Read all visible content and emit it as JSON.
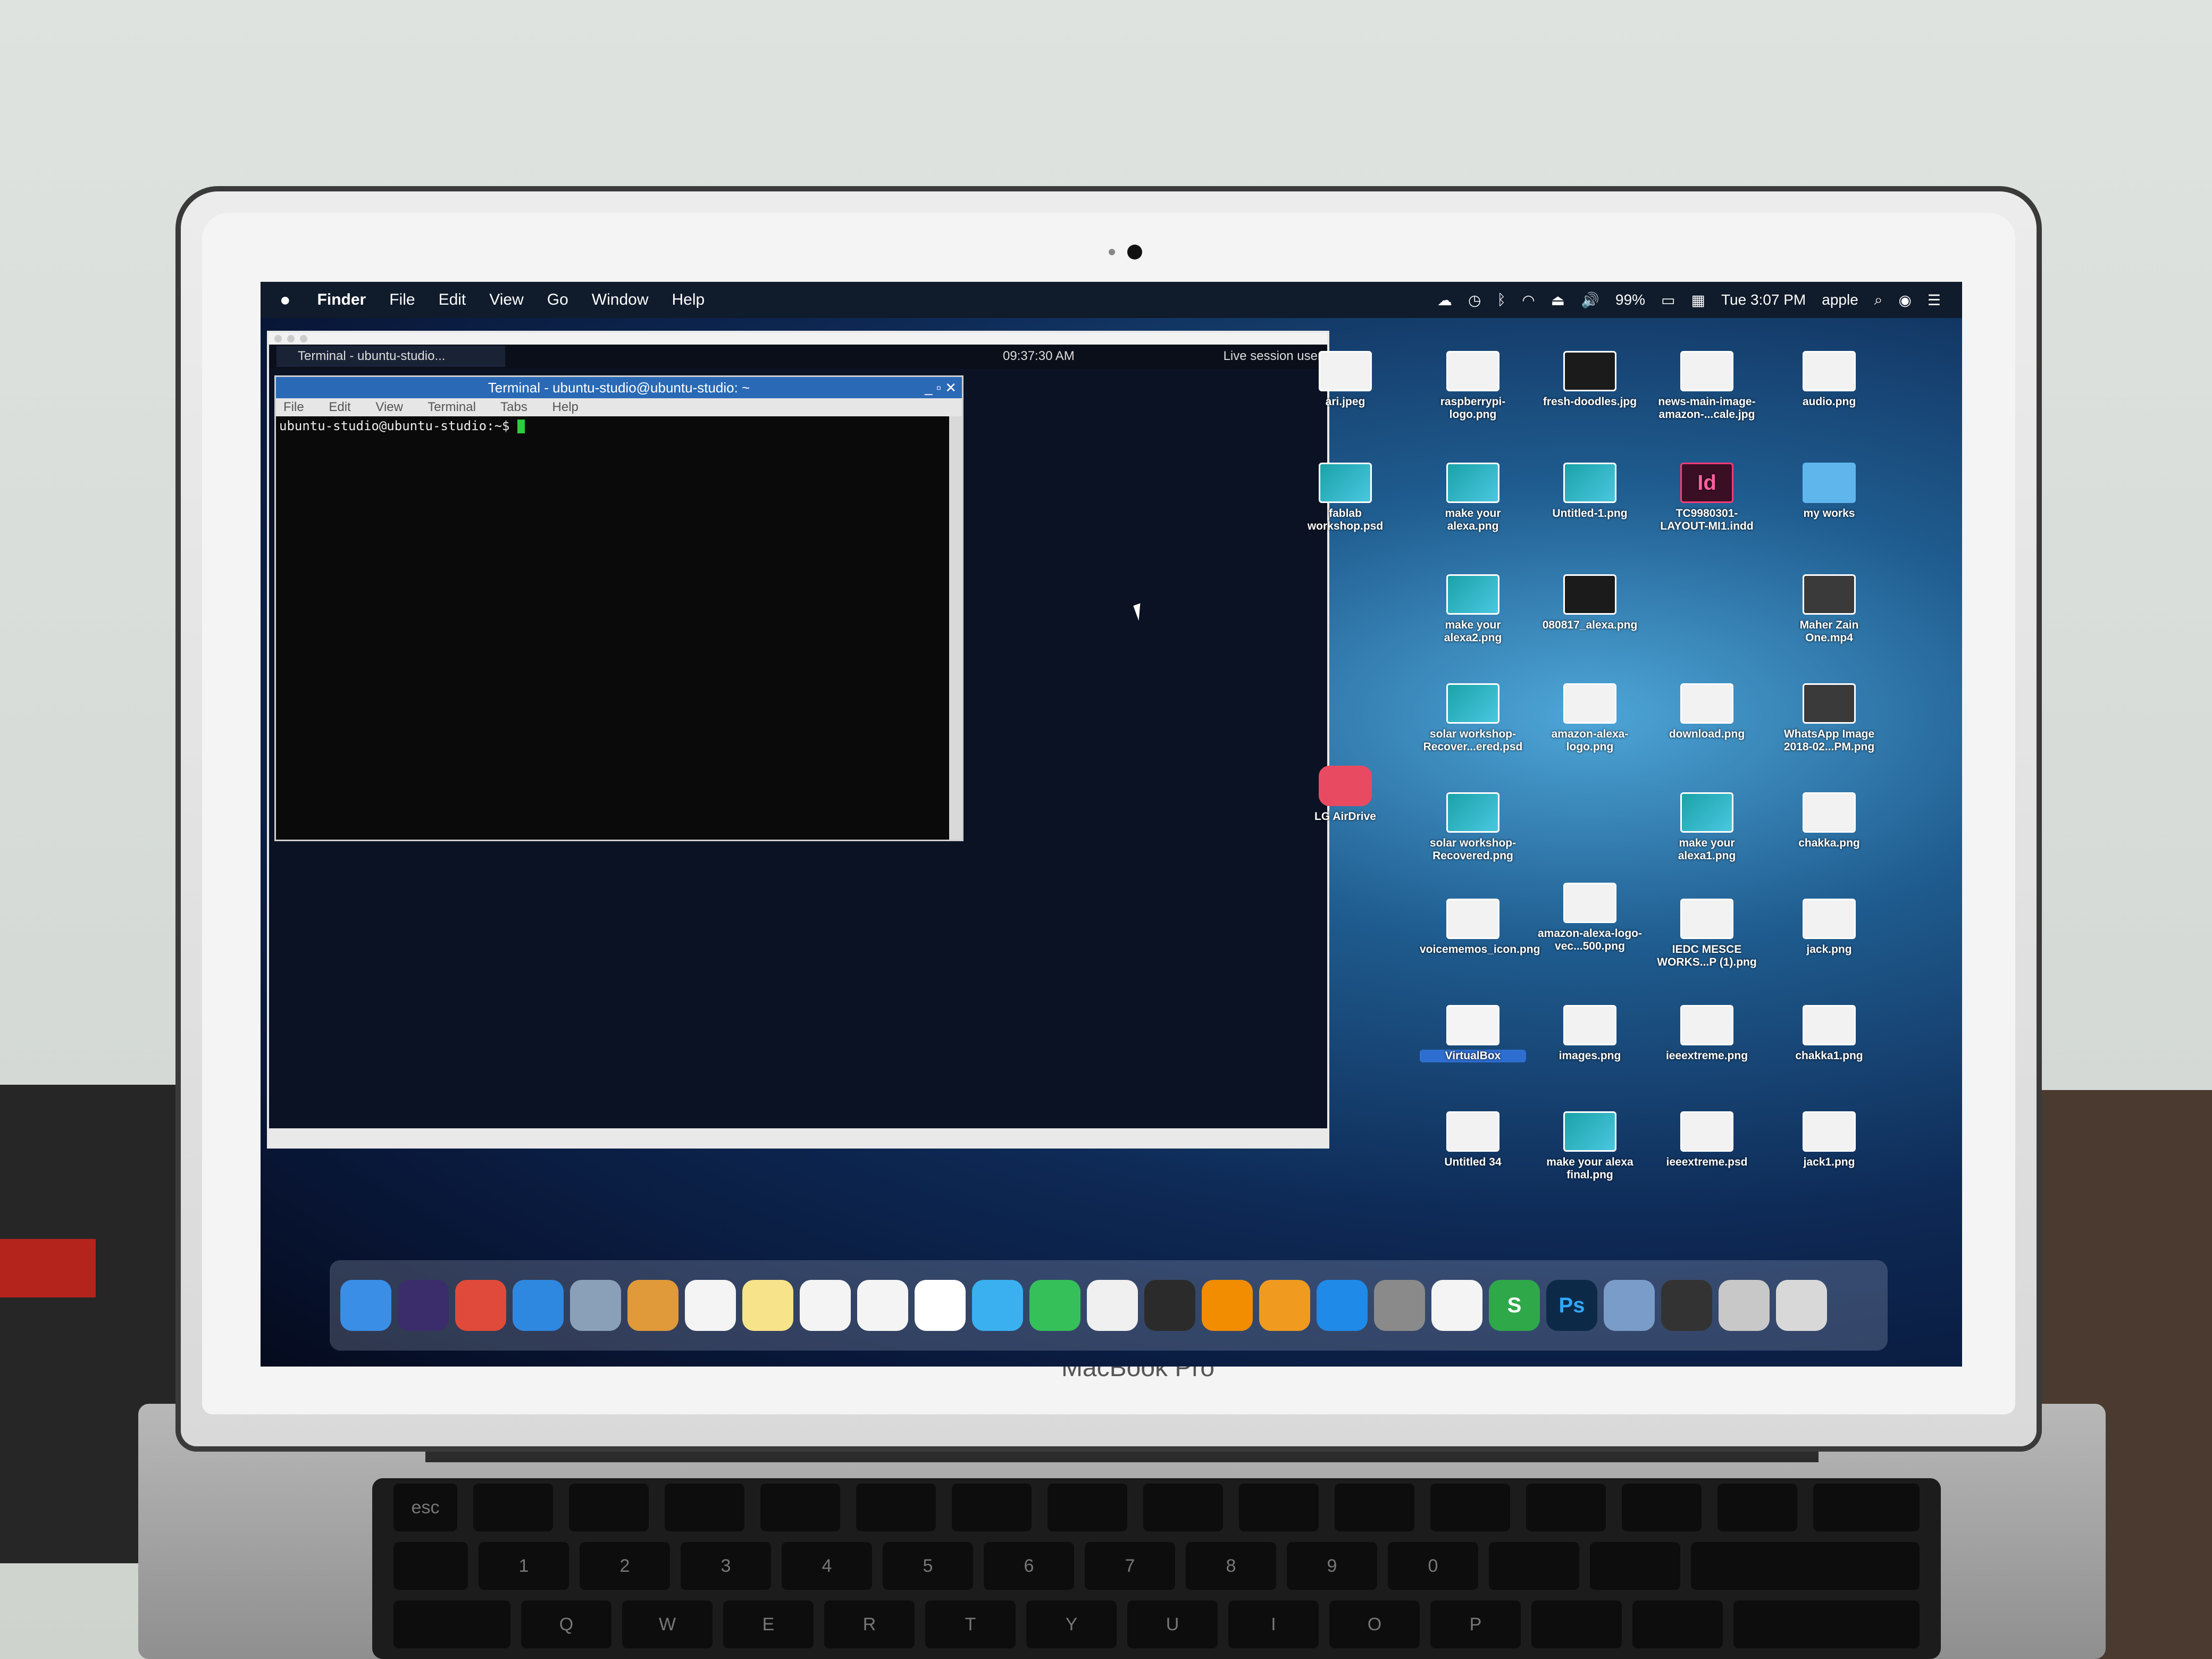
{
  "menubar": {
    "apple": "",
    "items": [
      "Finder",
      "File",
      "Edit",
      "View",
      "Go",
      "Window",
      "Help"
    ],
    "battery": "99%",
    "clock": "Tue 3:07 PM",
    "user": "apple"
  },
  "vm": {
    "panel_task": "Terminal - ubuntu-studio...",
    "panel_clock": "09:37:30 AM",
    "session": "Live session user",
    "terminal_title": "Terminal - ubuntu-studio@ubuntu-studio: ~",
    "terminal_menu": [
      "File",
      "Edit",
      "View",
      "Terminal",
      "Tabs",
      "Help"
    ],
    "prompt": "ubuntu-studio@ubuntu-studio:~$ "
  },
  "desktop_icons": [
    {
      "label": "ari.jpeg"
    },
    {
      "label": "raspberrypi-logo.png"
    },
    {
      "label": "fresh-doodles.jpg"
    },
    {
      "label": "news-main-image-amazon-...cale.jpg"
    },
    {
      "label": "audio.png"
    },
    {
      "label": "fablab workshop.psd"
    },
    {
      "label": "make your alexa.png"
    },
    {
      "label": "Untitled-1.png"
    },
    {
      "label": "TC9980301-LAYOUT-MI1.indd"
    },
    {
      "label": "my works"
    },
    {
      "label": "make your alexa2.png"
    },
    {
      "label": "080817_alexa.png"
    },
    {
      "label": "Maher Zain One.mp4"
    },
    {
      "label": "solar workshop-Recover...ered.psd"
    },
    {
      "label": "amazon-alexa-logo.png"
    },
    {
      "label": "download.png"
    },
    {
      "label": "WhatsApp Image 2018-02...PM.png"
    },
    {
      "label": "LG AirDrive"
    },
    {
      "label": "solar workshop-Recovered.png"
    },
    {
      "label": "make your alexa1.png"
    },
    {
      "label": "chakka.png"
    },
    {
      "label": "voicememos_icon.png"
    },
    {
      "label": "amazon-alexa-logo-vec...500.png"
    },
    {
      "label": "IEDC MESCE WORKS...P (1).png"
    },
    {
      "label": "jack.png"
    },
    {
      "label": "VirtualBox"
    },
    {
      "label": "images.png"
    },
    {
      "label": "ieeextreme.png"
    },
    {
      "label": "chakka1.png"
    },
    {
      "label": "Untitled 34"
    },
    {
      "label": "make your alexa final.png"
    },
    {
      "label": "ieeextreme.psd"
    },
    {
      "label": "jack1.png"
    }
  ],
  "dock": [
    "finder-icon",
    "siri-icon",
    "chrome-icon",
    "safari-icon",
    "preview-icon",
    "notes-icon",
    "calendar-icon",
    "stickies-icon",
    "textedit-icon",
    "pages-icon",
    "photos-icon",
    "messages-icon",
    "facetime-icon",
    "itunes-icon",
    "quicktime-icon",
    "vlc-icon",
    "ibooks-icon",
    "appstore-icon",
    "system-preferences-icon",
    "document-icon",
    "numbers-icon",
    "photoshop-icon",
    "virtualbox-icon",
    "display-icon",
    "downloads-icon",
    "trash-icon"
  ],
  "dock_ps_label": "Ps",
  "dock_s_label": "S",
  "laptop_brand": "MacBook Pro",
  "keys": [
    "esc",
    "!",
    "@",
    "#",
    "$",
    "%",
    "^",
    "&",
    "*",
    "(",
    ")",
    "Q",
    "W",
    "E",
    "R",
    "T",
    "Y",
    "U",
    "I",
    "O",
    "P",
    "1",
    "2",
    "3",
    "4",
    "5",
    "6",
    "7",
    "8",
    "9",
    "0"
  ]
}
